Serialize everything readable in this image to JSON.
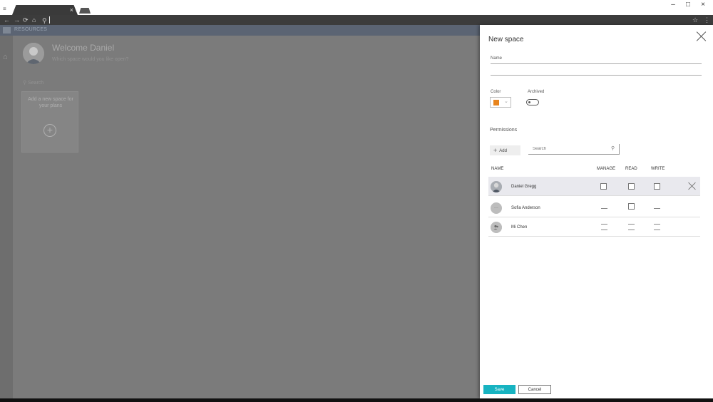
{
  "browser": {
    "tab_close_glyph": "×",
    "win_minimize": "–",
    "win_maximize": "□",
    "win_close": "×"
  },
  "app": {
    "header_label": "RESOURCES",
    "welcome_title": "Welcome Daniel",
    "welcome_subtitle": "Which space would you like open?",
    "search_placeholder": "Search",
    "add_card_text": "Add a new space for your plans",
    "add_card_plus": "+"
  },
  "dialog": {
    "title": "New space",
    "name_label": "Name",
    "name_value": "",
    "color_label": "Color",
    "color_value": "#e8841c",
    "archived_label": "Archived",
    "archived_on": false,
    "permissions_label": "Permissions",
    "add_label": "Add",
    "add_plus": "+",
    "search_placeholder": "Search",
    "columns": {
      "name": "NAME",
      "manage": "MANAGE",
      "read": "READ",
      "write": "WRITE"
    },
    "rows": [
      {
        "name": "Daniel Gregg",
        "avatar": "photo",
        "manage": false,
        "read": false,
        "write": false,
        "selected": true
      },
      {
        "name": "Sofia Anderson",
        "avatar": "···",
        "read": false
      },
      {
        "name": "Mi Chen",
        "avatar": "person"
      }
    ],
    "save_label": "Save",
    "cancel_label": "Cancel"
  },
  "icons": {
    "search": "⚲",
    "home": "⌂",
    "chevron": "⌄"
  }
}
